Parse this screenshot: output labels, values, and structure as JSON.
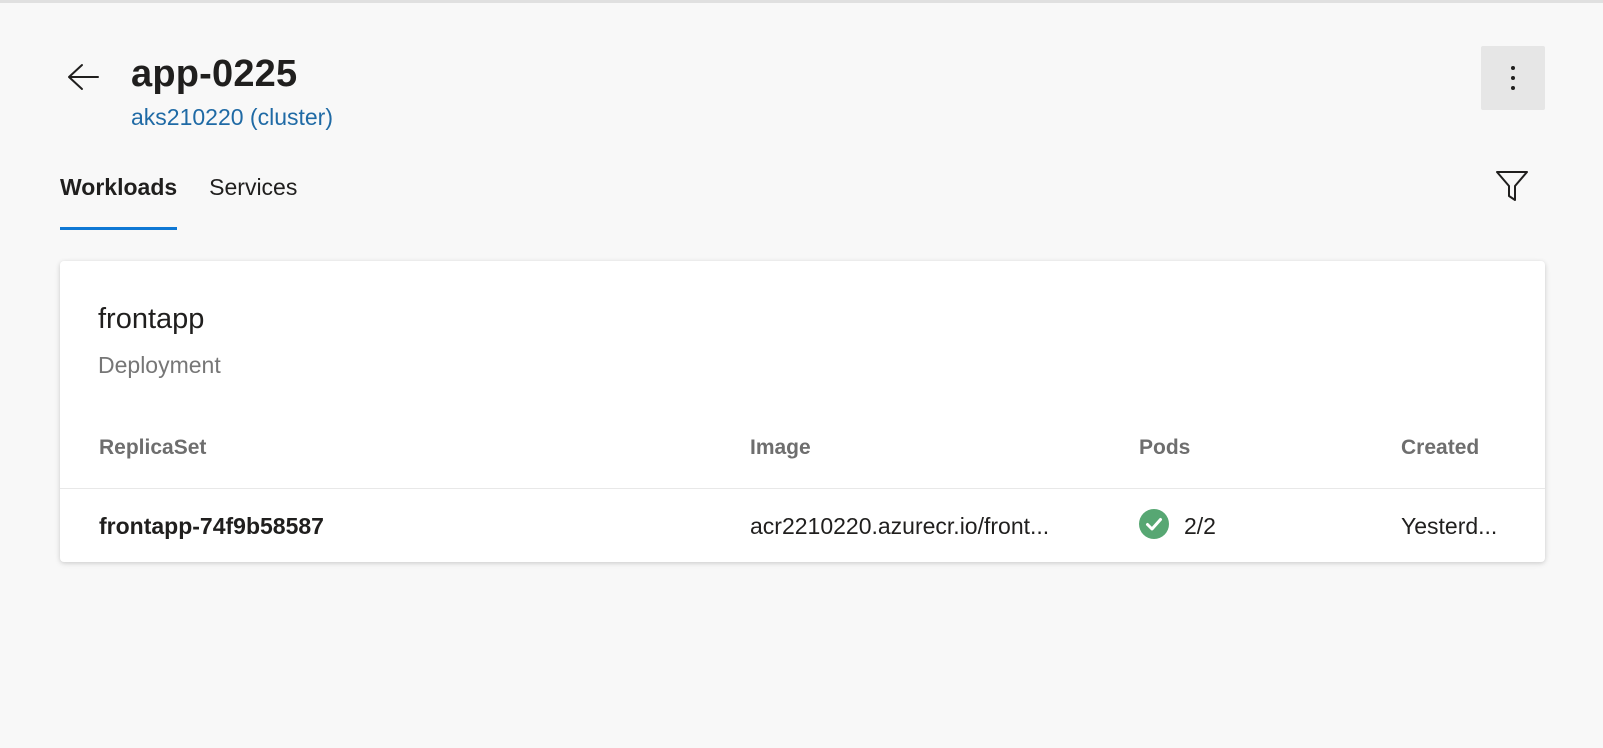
{
  "header": {
    "title": "app-0225",
    "cluster_link": "aks210220 (cluster)"
  },
  "tabs": [
    {
      "label": "Workloads",
      "active": true
    },
    {
      "label": "Services",
      "active": false
    }
  ],
  "workload": {
    "name": "frontapp",
    "kind": "Deployment",
    "columns": [
      "ReplicaSet",
      "Image",
      "Pods",
      "Created"
    ],
    "rows": [
      {
        "replicaset": "frontapp-74f9b58587",
        "image": "acr2210220.azurecr.io/front...",
        "pods": "2/2",
        "pods_status": "healthy",
        "created": "Yesterd..."
      }
    ]
  },
  "icons": {
    "back": "arrow-left-icon",
    "more": "more-vertical-icon",
    "filter": "filter-icon",
    "status": "check-circle-icon"
  },
  "colors": {
    "accent": "#0f78d4",
    "link": "#1f6aa5",
    "success": "#57a773"
  }
}
